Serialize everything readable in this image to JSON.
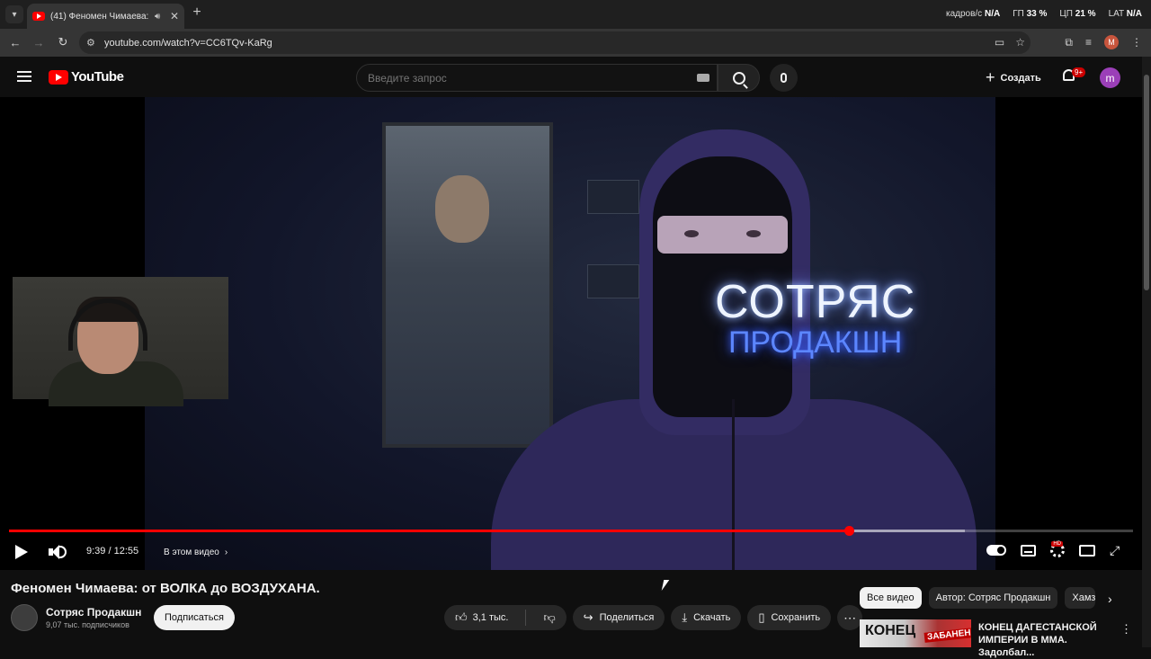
{
  "browser": {
    "tab_title": "(41) Феномен Чимаева: от ВОЛКА до ВОЗДУХАНА - YouTube",
    "url": "youtube.com/watch?v=CC6TQv-KaRg",
    "profile_letter": "M",
    "overlay": {
      "fps_label": "кадров/с",
      "fps_value": "N/A",
      "gpu_label": "ГП",
      "gpu_value": "33 %",
      "cpu_label": "ЦП",
      "cpu_value": "21 %",
      "lat_label": "LAT",
      "lat_value": "N/A"
    }
  },
  "youtube": {
    "logo_text": "YouTube",
    "search_placeholder": "Введите запрос",
    "create_label": "Создать",
    "notifications_badge": "9+",
    "avatar_letter": "m"
  },
  "player": {
    "neon_line1": "СОТРЯС",
    "neon_line2": "ПРОДАКШН",
    "time": "9:39 / 12:55",
    "chapters_label": "В этом видео",
    "progress": 0.747,
    "buffered": 0.85
  },
  "video": {
    "title": "Феномен Чимаева: от ВОЛКА до ВОЗДУХАНА.",
    "channel_name": "Сотряс Продакшн",
    "subscribers": "9,07 тыс. подписчиков",
    "subscribe_label": "Подписаться",
    "likes": "3,1 тыс.",
    "share_label": "Поделиться",
    "download_label": "Скачать",
    "save_label": "Сохранить"
  },
  "sidebar": {
    "chips": [
      "Все видео",
      "Автор: Сотряс Продакшн",
      "Хамзат"
    ],
    "recommendation": {
      "thumb_text": "КОНЕЦ",
      "thumb_stamp": "ЗАБАНЕН",
      "title": "КОНЕЦ ДАГЕСТАНСКОЙ ИМПЕРИИ В ММА. Задолбал..."
    }
  }
}
